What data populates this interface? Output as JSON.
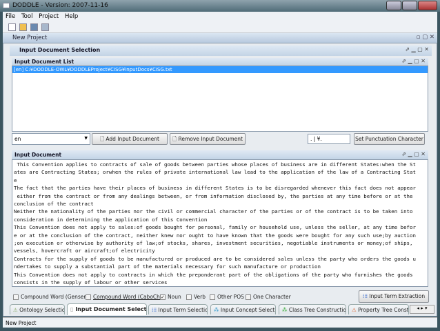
{
  "window": {
    "title": "DODDLE - Version: 2007-11-16"
  },
  "menu": [
    "File",
    "Tool",
    "Project",
    "Help"
  ],
  "toolbar": {
    "icons": [
      "new-icon",
      "open-icon",
      "save-icon",
      "save-as-icon"
    ]
  },
  "internal_frame": {
    "title": "New Project"
  },
  "panel": {
    "title": "Input Document Selection"
  },
  "doc_list": {
    "title": "Input Document List",
    "items": [
      "[en] C:¥DODDLE-OWL¥DODDLEProject¥CISG¥inputDocs¥CISG.txt"
    ],
    "selected_index": 0
  },
  "controls": {
    "language": "en",
    "add_label": "Add Input Document",
    "remove_label": "Remove Input Document",
    "punctuation_value": ". | ¥.",
    "set_punct_label": "Set Punctuation Character"
  },
  "input_document": {
    "title": "Input Document",
    "lines": [
      " This Convention applies to contracts of sale of goods between parties whose places of business are in different States:when the St",
      "ates are Contracting States; orwhen the rules of private international law lead to the application of the law of a Contracting Stat",
      "e",
      "The fact that the parties have their places of business in different States is to be disregarded whenever this fact does not appear",
      " either from the contract or from any dealings between, or from information disclosed by, the parties at any time before or at the",
      "conclusion of the contract",
      "Neither the nationality of the parties nor the civil or commercial character of the parties or of the contract is to be taken into",
      "consideration in determining the application of this Convention",
      "This Convention does not apply to sales:of goods bought for personal, family or household use, unless the seller, at any time befor",
      "e or at the conclusion of the contract, neither knew nor ought to have known that the goods were bought for any such use;by auction",
      ";on execution or otherwise by authority of law;of stocks, shares, investment securities, negotiable instruments or money;of ships,",
      "vessels, hovercraft or aircraft;of electricity",
      "Contracts for the supply of goods to be manufactured or produced are to be considered sales unless the party who orders the goods u",
      "ndertakes to supply a substantial part of the materials necessary for such manufacture or production",
      "This Convention does not apply to contracts in which the preponderant part of the obligations of the party who furnishes the goods",
      "consists in the supply of labour or other services"
    ]
  },
  "options": [
    {
      "label": "Compound Word (Gensen)",
      "checked": false
    },
    {
      "label": "Compound Word (CaboCha)",
      "checked": false
    },
    {
      "label": "Noun",
      "checked": true
    },
    {
      "label": "Verb",
      "checked": false
    },
    {
      "label": "Other POS",
      "checked": false
    },
    {
      "label": "One Character",
      "checked": false
    }
  ],
  "extract_label": "Input Term Extraction",
  "tabs": [
    "Ontology Selection",
    "Input Document Selection",
    "Input Term Selection",
    "Input Concept Selection",
    "Class Tree Construction",
    "Property Tree Constr"
  ],
  "active_tab": 1,
  "status": "New Project"
}
